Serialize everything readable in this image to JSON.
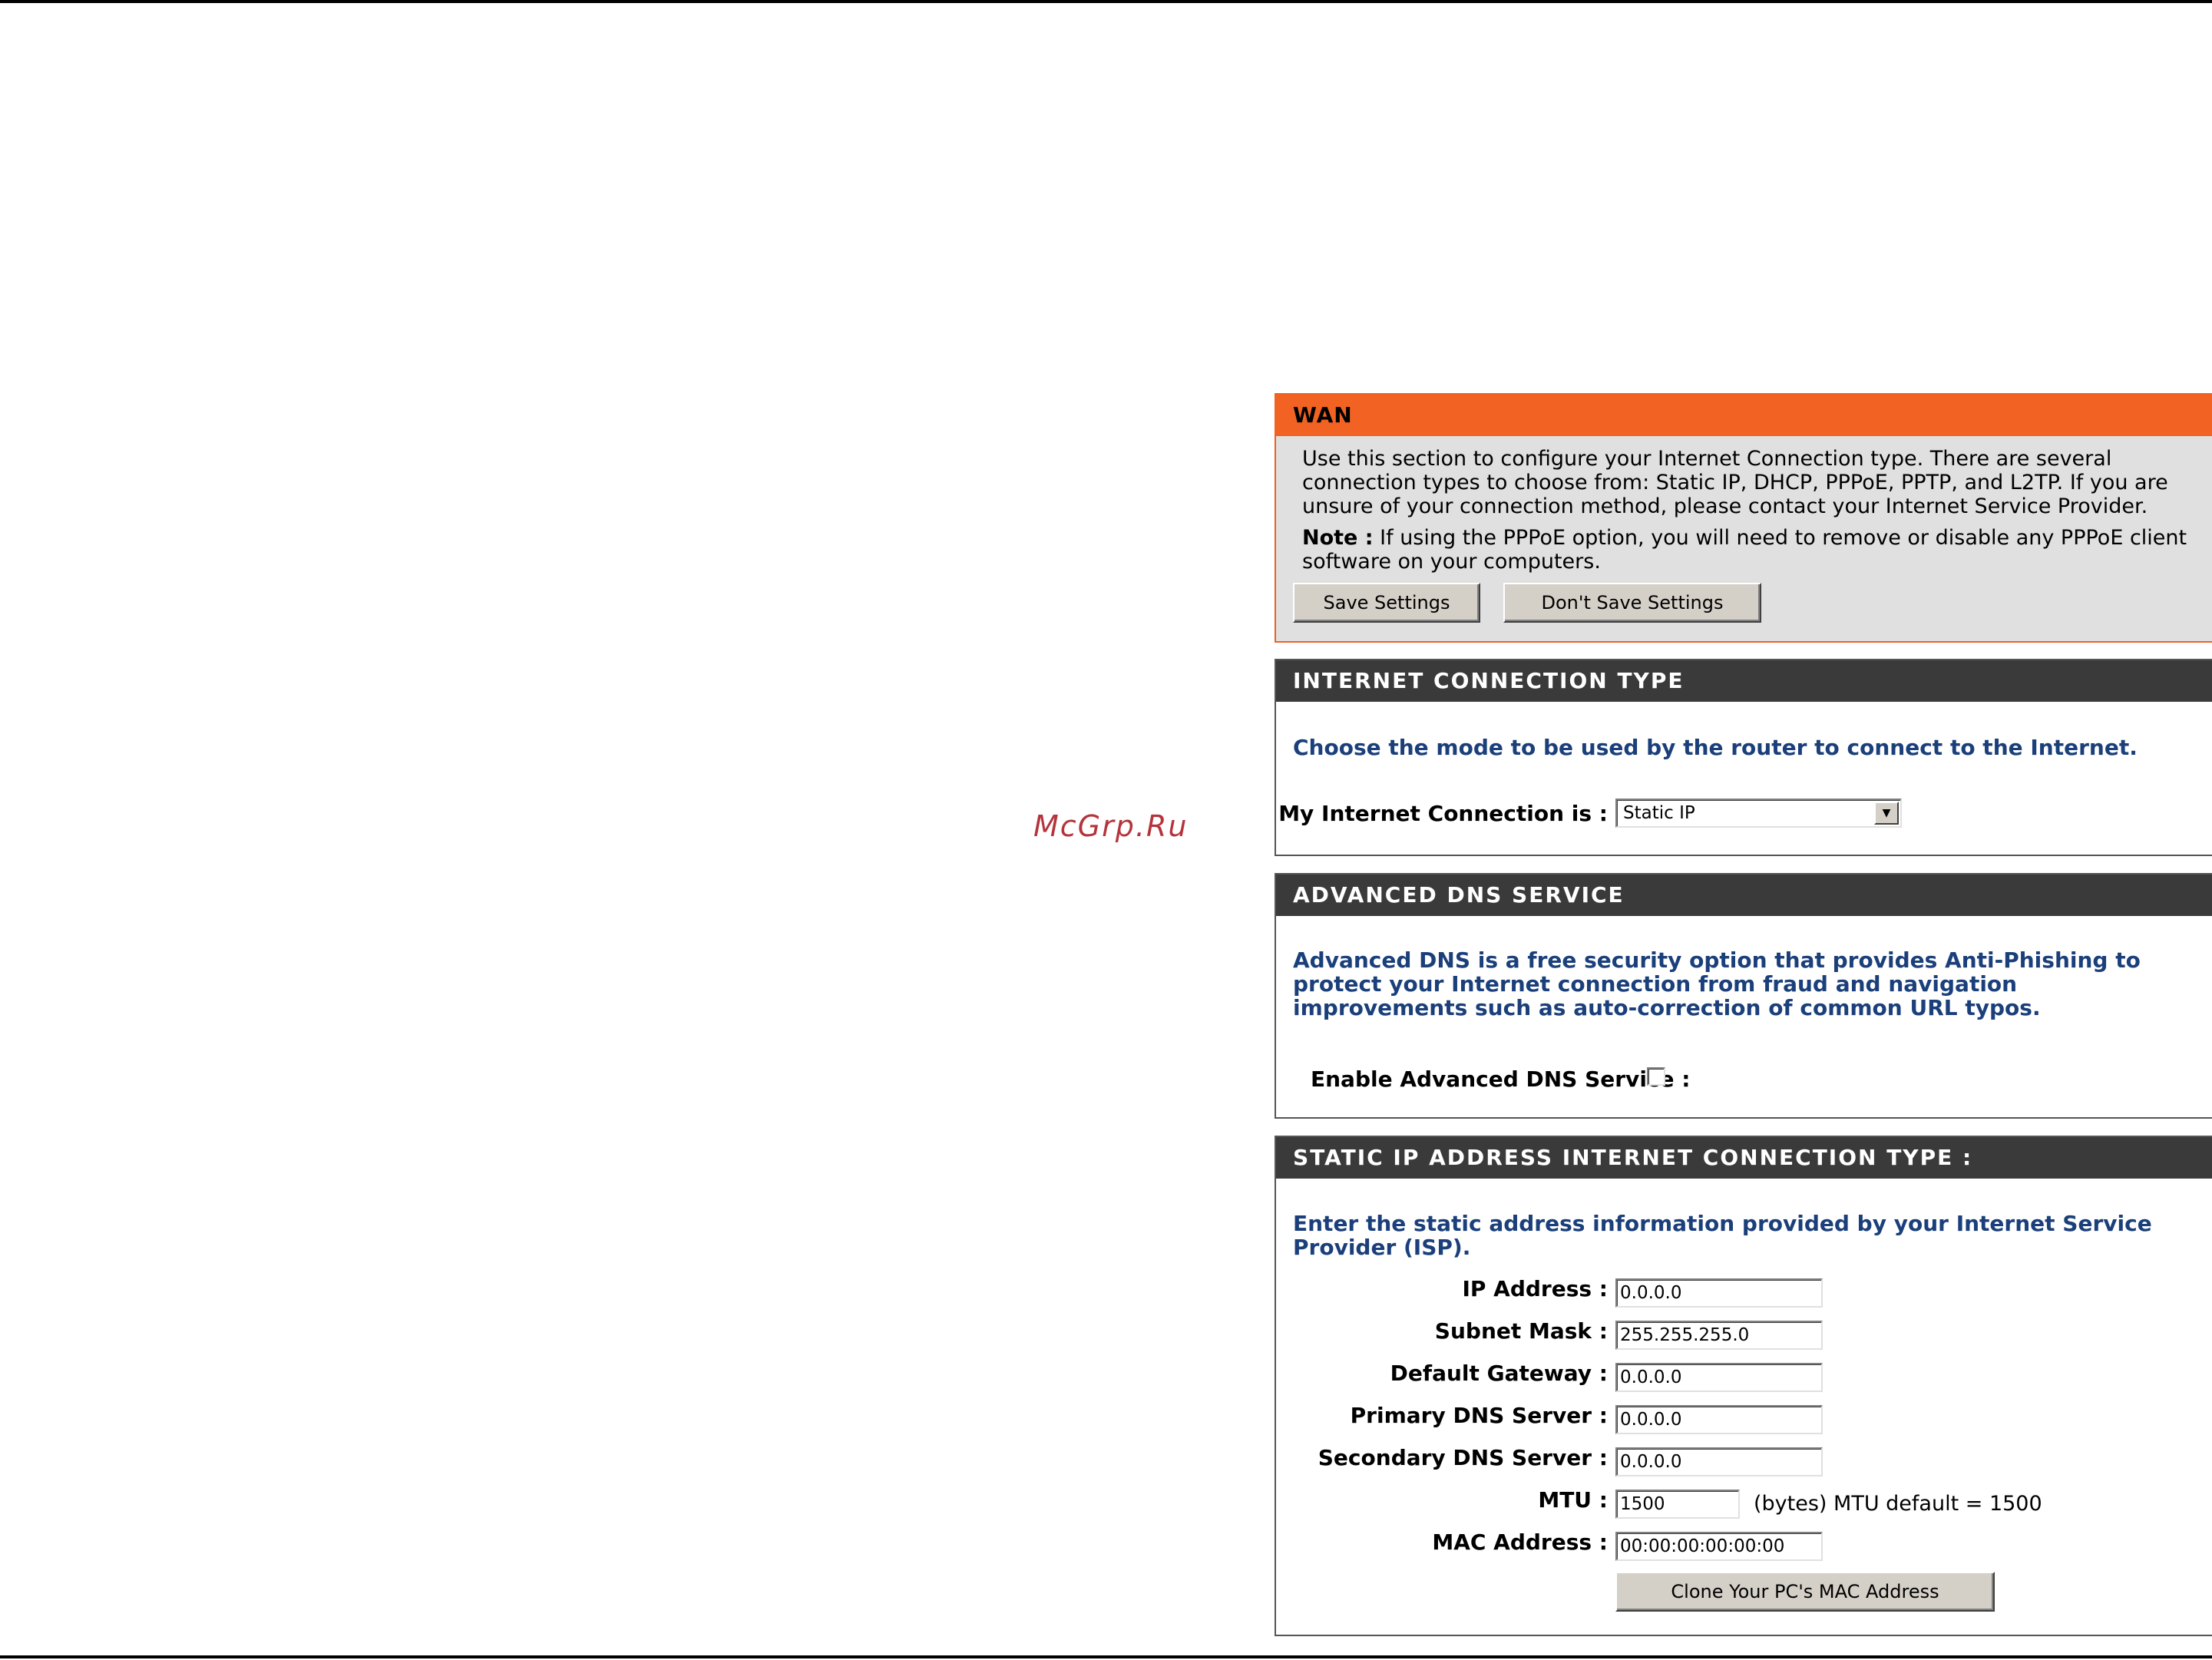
{
  "watermark": "McGrp.Ru",
  "wan": {
    "title": "WAN",
    "description": "Use this section to configure your Internet Connection type. There are several connection types to choose from: Static IP, DHCP, PPPoE, PPTP, and L2TP. If you are unsure of your connection method, please contact your Internet Service Provider.",
    "note_label": "Note :",
    "note_text": " If using the PPPoE option, you will need to remove or disable any PPPoE client software on your computers.",
    "save_label": "Save Settings",
    "dont_save_label": "Don't Save Settings"
  },
  "connection_type": {
    "title": "INTERNET CONNECTION TYPE",
    "lead": "Choose the mode to be used by the router to connect to the Internet.",
    "label": "My Internet Connection is :",
    "selected": "Static IP"
  },
  "advanced_dns": {
    "title": "ADVANCED DNS SERVICE",
    "lead": "Advanced DNS is a free security option that provides Anti-Phishing to protect your Internet connection from fraud and navigation improvements such as auto-correction of common URL typos.",
    "label": "Enable Advanced DNS Service :",
    "enabled": false
  },
  "static_ip": {
    "title": "STATIC IP ADDRESS INTERNET CONNECTION TYPE :",
    "lead": "Enter the static address information provided by your Internet Service Provider (ISP).",
    "fields": [
      {
        "label": "IP Address :",
        "value": "0.0.0.0"
      },
      {
        "label": "Subnet Mask :",
        "value": "255.255.255.0"
      },
      {
        "label": "Default Gateway :",
        "value": "0.0.0.0"
      },
      {
        "label": "Primary DNS Server :",
        "value": "0.0.0.0"
      },
      {
        "label": "Secondary DNS Server :",
        "value": "0.0.0.0"
      },
      {
        "label": "MTU :",
        "value": "1500"
      },
      {
        "label": "MAC Address :",
        "value": "00:00:00:00:00:00"
      }
    ],
    "mtu_note": "(bytes) MTU default = 1500",
    "clone_label": "Clone Your PC's MAC Address"
  }
}
